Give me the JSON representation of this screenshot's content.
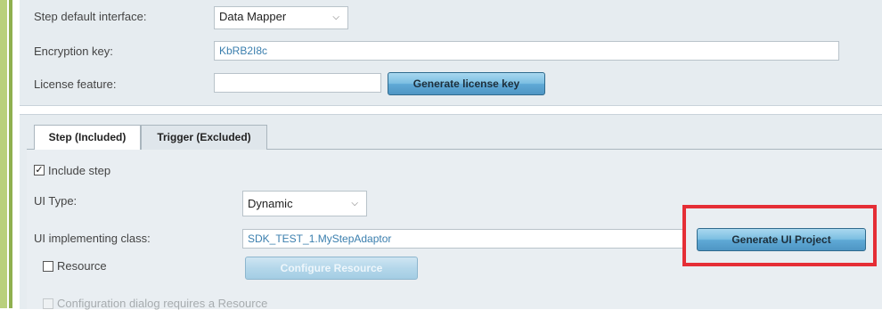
{
  "top_panel": {
    "step_default_interface_label": "Step default interface:",
    "step_default_interface_value": "Data Mapper",
    "encryption_key_label": "Encryption key:",
    "encryption_key_value": "KbRB2I8c",
    "license_feature_label": "License feature:",
    "license_feature_value": "",
    "generate_license_key_label": "Generate license key"
  },
  "tabs": [
    {
      "label": "Step (Included)",
      "active": true
    },
    {
      "label": "Trigger (Excluded)",
      "active": false
    }
  ],
  "step_tab": {
    "include_step_label": "Include step",
    "include_step_checked": true,
    "ui_type_label": "UI Type:",
    "ui_type_value": "Dynamic",
    "ui_class_label": "UI implementing class:",
    "ui_class_value": "SDK_TEST_1.MyStepAdaptor",
    "generate_ui_project_label": "Generate UI Project",
    "resource_label": "Resource",
    "resource_checked": false,
    "configure_resource_label": "Configure Resource",
    "config_dialog_label": "Configuration dialog requires a Resource",
    "config_dialog_checked": false
  },
  "colors": {
    "highlight": "#e52e36",
    "button": "#5fa9d6",
    "panel": "#e6ecf0",
    "accent": "#a9c46b"
  },
  "icons": {
    "dropdown": "chevron-down-icon",
    "check": "checkmark-icon"
  }
}
